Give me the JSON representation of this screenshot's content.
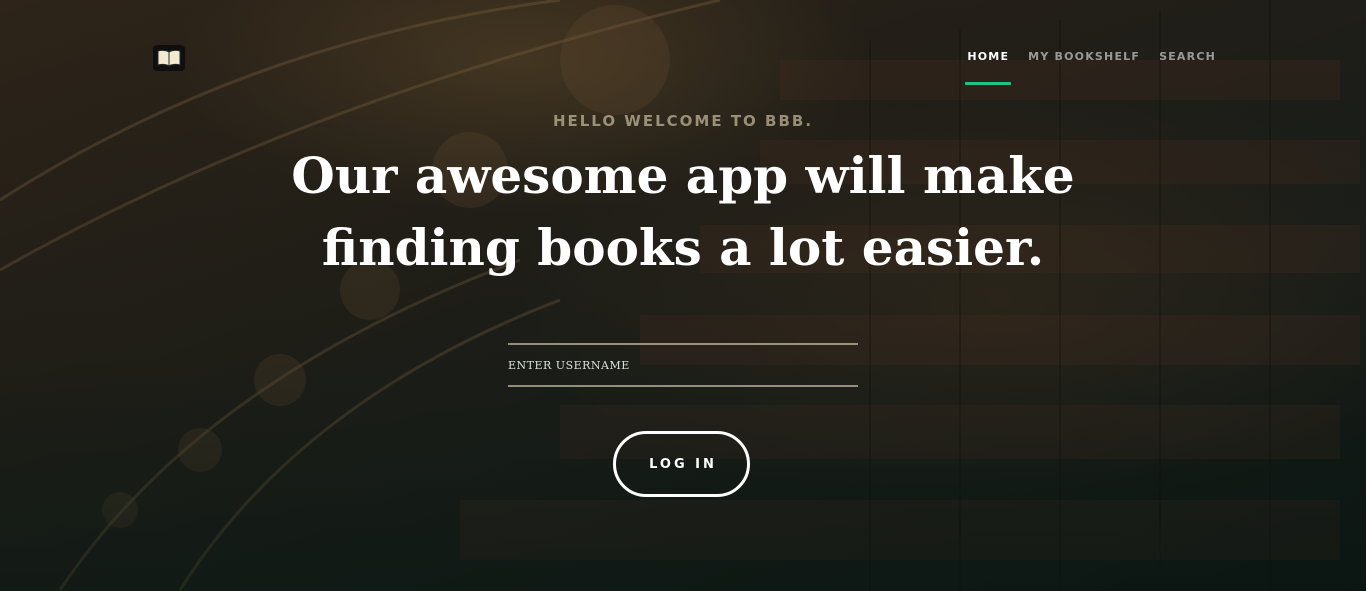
{
  "header": {
    "logo_icon": "open-book-icon",
    "nav": [
      {
        "label": "HOME",
        "active": true
      },
      {
        "label": "MY BOOKSHELF",
        "active": false
      },
      {
        "label": "SEARCH",
        "active": false
      }
    ]
  },
  "hero": {
    "eyebrow": "HELLO WELCOME TO BBB.",
    "headline_line1": "Our awesome app will make",
    "headline_line2": "finding books a lot easier.",
    "background": "library-hall-photo"
  },
  "login": {
    "username_placeholder": "ENTER USERNAME",
    "username_value": "",
    "button_label": "LOG IN"
  },
  "colors": {
    "accent": "#1fc28a",
    "nav_inactive": "#8c8c85",
    "text": "#ffffff"
  }
}
